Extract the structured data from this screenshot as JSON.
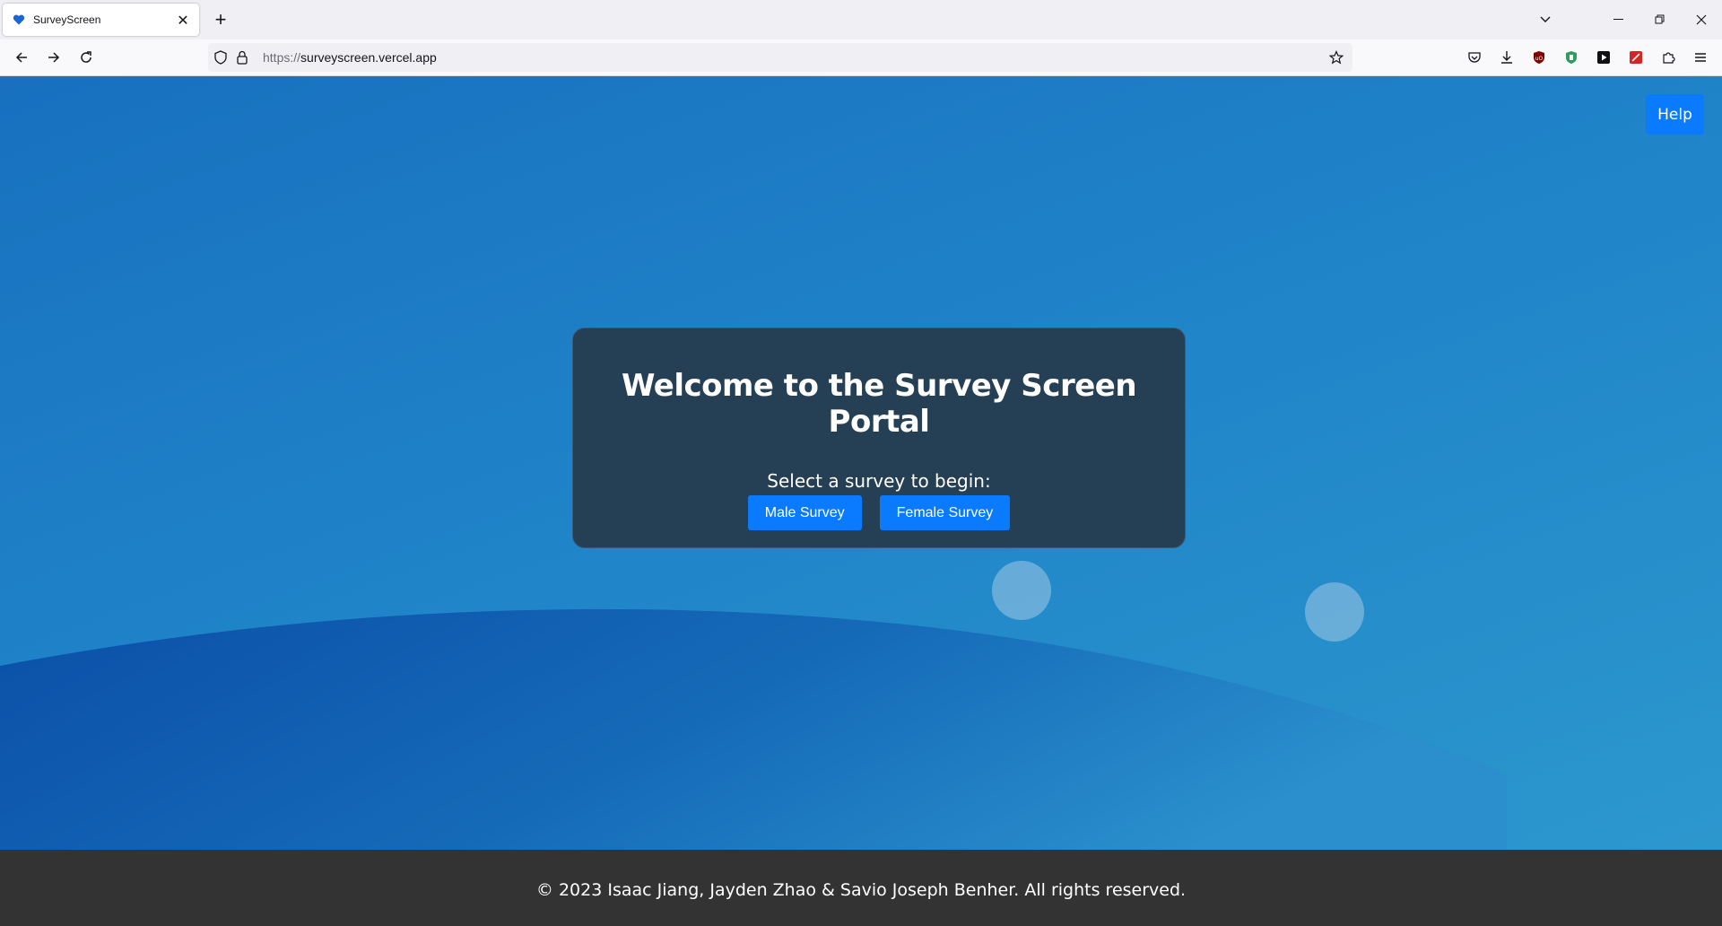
{
  "browser": {
    "tab_title": "SurveyScreen",
    "url_scheme": "https://",
    "url_host": "surveyscreen.vercel.app"
  },
  "page": {
    "help_label": "Help",
    "card": {
      "title": "Welcome to the Survey Screen Portal",
      "subtitle": "Select a survey to begin:",
      "buttons": [
        "Male Survey",
        "Female Survey"
      ]
    },
    "footer_text": "© 2023 Isaac Jiang, Jayden Zhao & Savio Joseph Benher. All rights reserved."
  },
  "colors": {
    "accent": "#0a7bff",
    "card_bg": "#253f55",
    "footer_bg": "#333333",
    "page_gradient_start": "#1870bf",
    "page_gradient_end": "#2c97cd"
  },
  "icons": {
    "favicon": "blue-heart-icon",
    "back": "arrow-left-icon",
    "forward": "arrow-right-icon",
    "reload": "reload-icon",
    "tracking": "shield-icon",
    "lock": "lock-icon",
    "bookmark": "star-icon",
    "pocket": "pocket-icon",
    "downloads": "download-icon",
    "menu": "hamburger-icon"
  }
}
